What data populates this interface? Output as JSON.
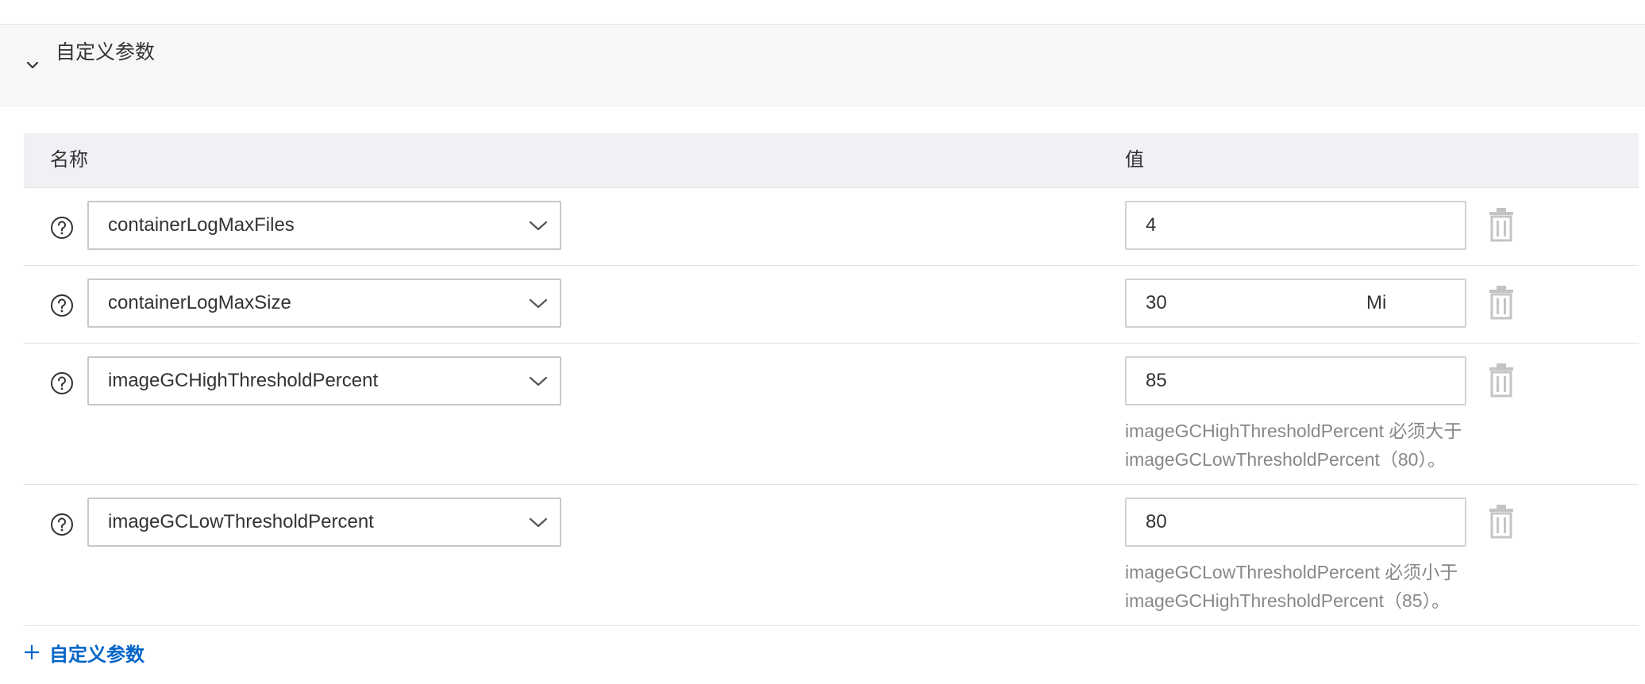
{
  "section": {
    "title": "自定义参数",
    "expanded": true
  },
  "table": {
    "headers": {
      "name": "名称",
      "value": "值"
    },
    "rows": [
      {
        "name": "containerLogMaxFiles",
        "value": "4",
        "unit": "",
        "hint_line1": "",
        "hint_line2": ""
      },
      {
        "name": "containerLogMaxSize",
        "value": "30",
        "unit": "Mi",
        "hint_line1": "",
        "hint_line2": ""
      },
      {
        "name": "imageGCHighThresholdPercent",
        "value": "85",
        "unit": "",
        "hint_line1": "imageGCHighThresholdPercent 必须大于",
        "hint_line2": "imageGCLowThresholdPercent（80）。"
      },
      {
        "name": "imageGCLowThresholdPercent",
        "value": "80",
        "unit": "",
        "hint_line1": "imageGCLowThresholdPercent 必须小于",
        "hint_line2": "imageGCHighThresholdPercent（85）。"
      }
    ]
  },
  "add_button": {
    "label": "自定义参数"
  },
  "colors": {
    "accent": "#0064c8",
    "header_bg": "#eff1f5",
    "section_bg": "#f6f7f9",
    "hint_text": "#888888",
    "icon_gray": "#c4c4c4"
  },
  "icons": {
    "collapse": "chevron-down-icon",
    "help": "question-circle-icon",
    "dropdown": "chevron-down-icon",
    "delete": "trash-icon",
    "add": "plus-icon"
  }
}
